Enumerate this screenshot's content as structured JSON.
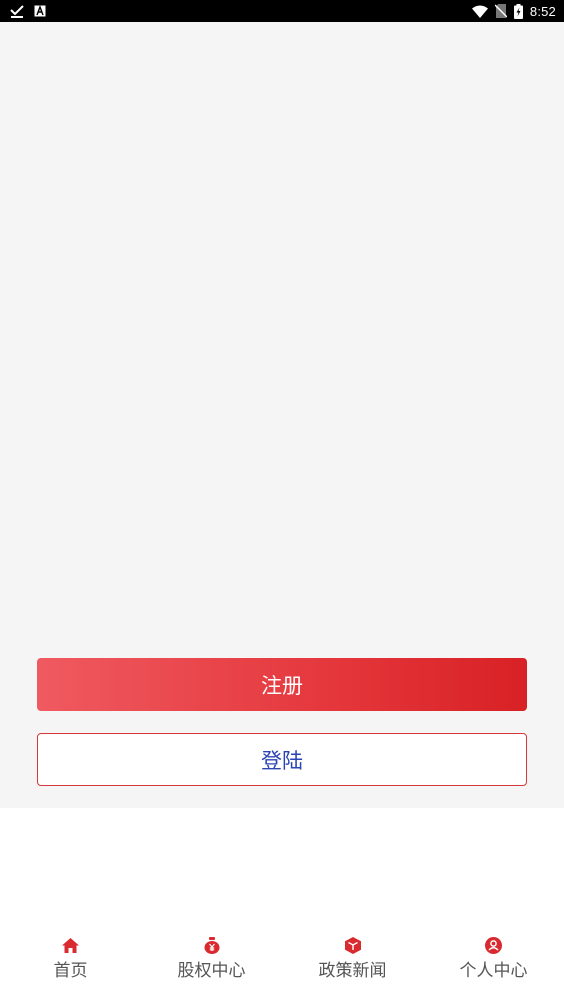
{
  "status_bar": {
    "time": "8:52",
    "left_icons": [
      "download-done-icon",
      "keyboard-a-icon"
    ],
    "right_icons": [
      "wifi-icon",
      "no-sim-icon",
      "battery-charging-icon"
    ]
  },
  "auth": {
    "register_label": "注册",
    "login_label": "登陆"
  },
  "tab_bar": {
    "items": [
      {
        "label": "首页",
        "icon": "home-icon"
      },
      {
        "label": "股权中心",
        "icon": "money-bag-icon"
      },
      {
        "label": "政策新闻",
        "icon": "cube-icon"
      },
      {
        "label": "个人中心",
        "icon": "user-circle-icon"
      }
    ]
  },
  "colors": {
    "accent": "#d82a2f",
    "login_text": "#2a43b5",
    "tab_label": "#555555",
    "background": "#f5f5f5"
  }
}
